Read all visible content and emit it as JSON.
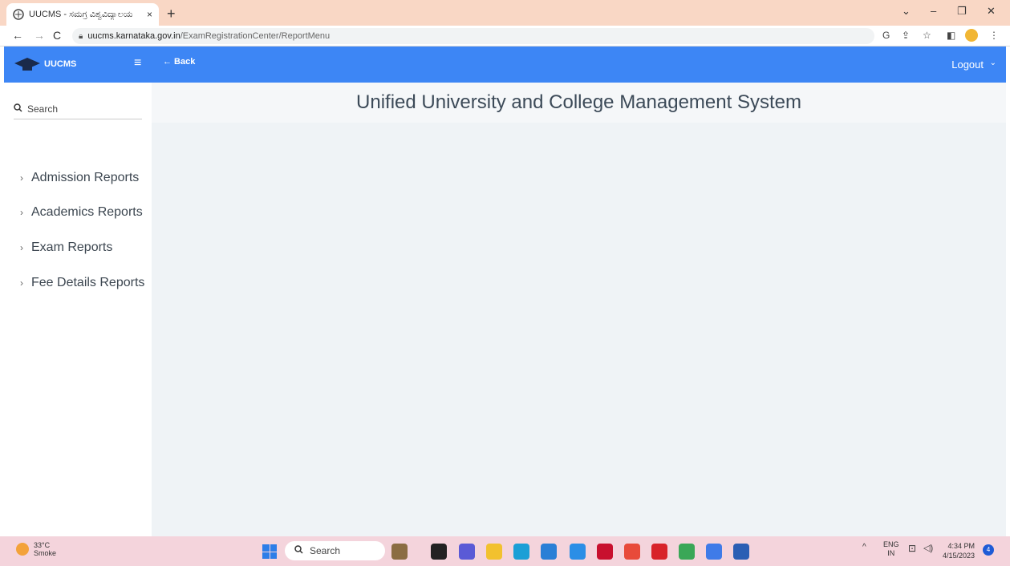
{
  "browser": {
    "tab_title": "UUCMS - ಸಮಗ್ರ ವಿಶ್ವವಿದ್ಯಾಲಯ",
    "tab_close": "×",
    "new_tab": "+",
    "url_host": "uucms.karnataka.gov.in",
    "url_path": "/ExamRegistrationCenter/ReportMenu",
    "window_controls": [
      "⌄",
      "–",
      "❐",
      "✕"
    ]
  },
  "header": {
    "logo_text": "UUCMS",
    "back_label": "← Back",
    "logout_label": "Logout",
    "brand_color": "#3d86f5"
  },
  "sidebar": {
    "search_placeholder": "Search",
    "items": [
      {
        "label": "Admission Reports"
      },
      {
        "label": "Academics Reports"
      },
      {
        "label": "Exam Reports"
      },
      {
        "label": "Fee Details Reports"
      }
    ]
  },
  "main": {
    "title": "Unified University and College Management System"
  },
  "taskbar": {
    "weather_temp": "33°C",
    "weather_desc": "Smoke",
    "search_label": "Search",
    "lang_top": "ENG",
    "lang_bottom": "IN",
    "time": "4:34 PM",
    "date": "4/15/2023",
    "notification_count": "4",
    "apps": [
      {
        "name": "photos-icon",
        "color": "#8b6d43"
      },
      {
        "name": "terminal-icon",
        "color": "#222222"
      },
      {
        "name": "chat-icon",
        "color": "#5a5ad6"
      },
      {
        "name": "file-explorer-icon",
        "color": "#f2c12e"
      },
      {
        "name": "edge-icon",
        "color": "#1b9fd6"
      },
      {
        "name": "mail-icon",
        "color": "#2a7fd6"
      },
      {
        "name": "help-icon",
        "color": "#2b8ee6"
      },
      {
        "name": "mcafee-icon",
        "color": "#c8102e"
      },
      {
        "name": "chrome-icon",
        "color": "#e84a3a"
      },
      {
        "name": "opera-icon",
        "color": "#d8232a"
      },
      {
        "name": "photo-viewer-icon",
        "color": "#3aa757"
      },
      {
        "name": "chrome-canary-icon",
        "color": "#3f7be8"
      },
      {
        "name": "word-icon",
        "color": "#2b5fb4"
      }
    ]
  }
}
